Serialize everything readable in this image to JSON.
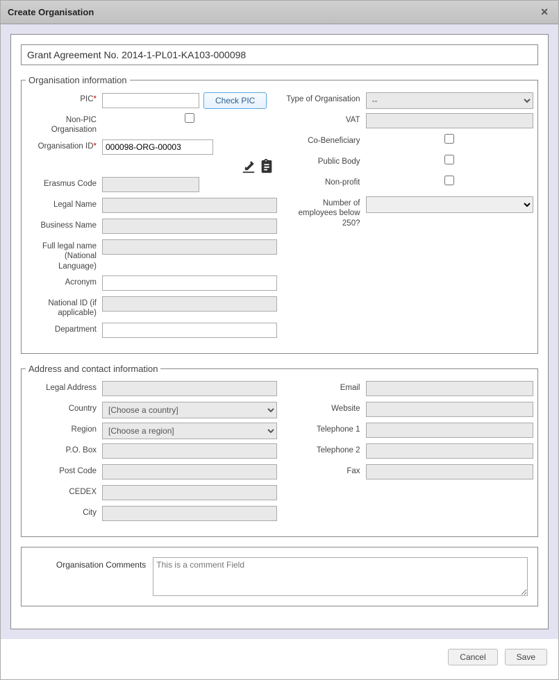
{
  "dialog": {
    "title": "Create Organisation"
  },
  "grant": {
    "label": "Grant Agreement No. 2014-1-PL01-KA103-000098"
  },
  "sections": {
    "orgInfo": "Organisation information",
    "address": "Address and contact information"
  },
  "org": {
    "pic_label": "PIC",
    "pic_value": "",
    "check_pic": "Check PIC",
    "nonpic_label": "Non-PIC Organisation",
    "orgid_label": "Organisation ID",
    "orgid_value": "000098-ORG-00003",
    "erasmus_label": "Erasmus Code",
    "legal_label": "Legal Name",
    "business_label": "Business Name",
    "fullname_label": "Full legal name (National Language)",
    "acronym_label": "Acronym",
    "national_label": "National ID (if applicable)",
    "dept_label": "Department",
    "type_label": "Type of Organisation",
    "type_value": "--",
    "vat_label": "VAT",
    "cobenef_label": "Co-Beneficiary",
    "public_label": "Public Body",
    "nonprofit_label": "Non-profit",
    "employees_label": "Number of employees below 250?"
  },
  "addr": {
    "legaladdr_label": "Legal Address",
    "country_label": "Country",
    "country_placeholder": "[Choose a country]",
    "region_label": "Region",
    "region_placeholder": "[Choose a region]",
    "pobox_label": "P.O. Box",
    "postcode_label": "Post Code",
    "cedex_label": "CEDEX",
    "city_label": "City",
    "email_label": "Email",
    "website_label": "Website",
    "tel1_label": "Telephone 1",
    "tel2_label": "Telephone 2",
    "fax_label": "Fax"
  },
  "comments": {
    "label": "Organisation Comments",
    "placeholder": "This is a comment Field"
  },
  "buttons": {
    "cancel": "Cancel",
    "save": "Save"
  }
}
